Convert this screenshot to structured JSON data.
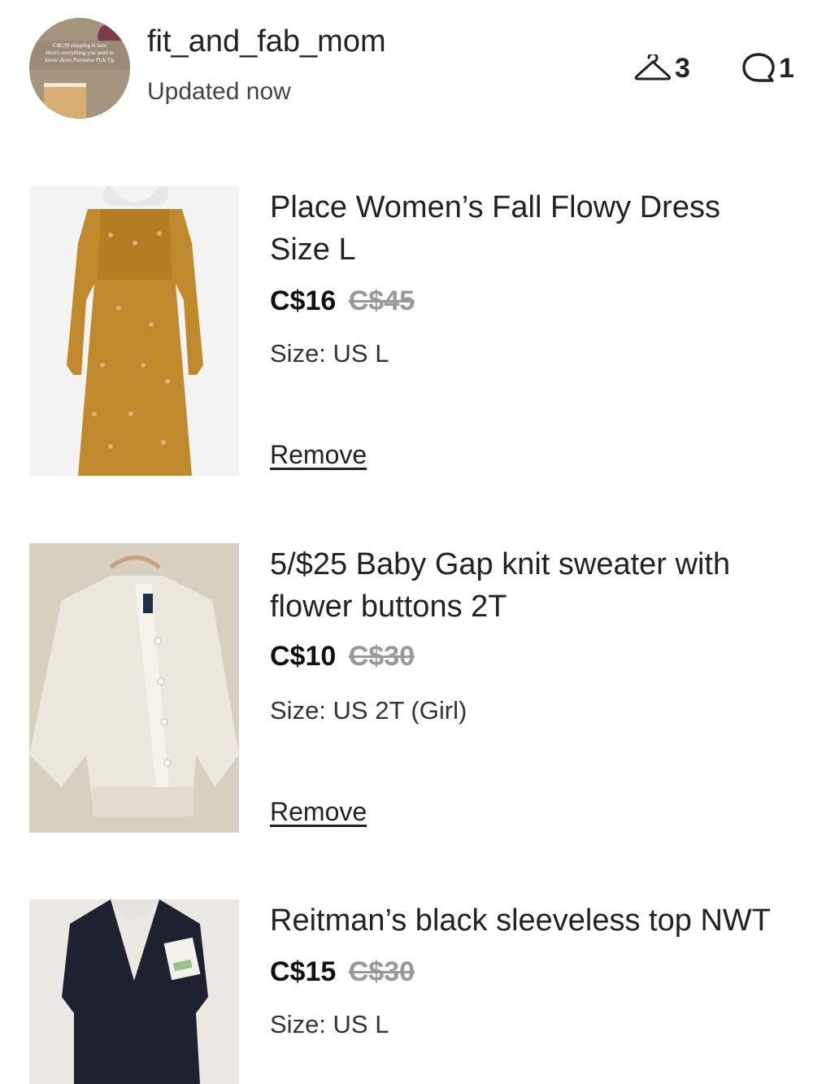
{
  "header": {
    "username": "fit_and_fab_mom",
    "updated": "Updated now",
    "avatar_text": [
      "C$6.99 shipping is here",
      "Here's everything you need to",
      "know about Purolator Pick Up"
    ],
    "likes_icon": "hanger-icon",
    "likes_count": "3",
    "comments_icon": "comment-icon",
    "comments_count": "1"
  },
  "items": [
    {
      "title_line1": "Place Women’s Fall Flowy Dress",
      "title_line2": "Size L",
      "price": "C$16",
      "original_price": "C$45",
      "size": "Size: US L",
      "remove_label": "Remove"
    },
    {
      "title_line1": "5/$25 Baby Gap knit sweater with",
      "title_line2": "flower buttons 2T",
      "price": "C$10",
      "original_price": "C$30",
      "size": "Size: US 2T (Girl)",
      "remove_label": "Remove"
    },
    {
      "title_line1": "Reitman’s black sleeveless top NWT",
      "price": "C$15",
      "original_price": "C$30",
      "size": "Size: US L"
    }
  ],
  "colors": {
    "text": "#222222",
    "strikethrough": "#999999",
    "background": "#ffffff"
  }
}
